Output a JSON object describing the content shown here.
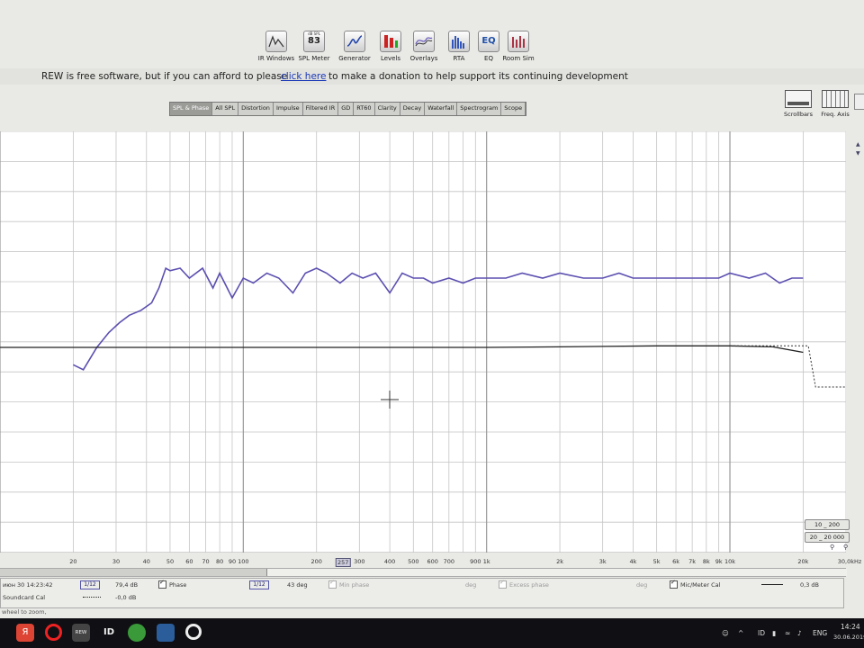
{
  "toolbar": {
    "buttons": [
      {
        "label": "IR Windows",
        "icon": "ir-window-icon"
      },
      {
        "label": "SPL Meter",
        "icon": "spl-meter-icon",
        "display": "83",
        "caption": "dB SPL"
      },
      {
        "label": "Generator",
        "icon": "generator-icon"
      },
      {
        "label": "Levels",
        "icon": "levels-icon"
      },
      {
        "label": "Overlays",
        "icon": "overlays-icon"
      },
      {
        "label": "RTA",
        "icon": "rta-icon"
      },
      {
        "label": "EQ",
        "icon": "eq-icon",
        "display": "EQ"
      },
      {
        "label": "Room Sim",
        "icon": "room-sim-icon"
      }
    ]
  },
  "banner": {
    "text_before": "REW is free software, but if you can afford to please",
    "link": "click here",
    "text_after": "to make a donation to help support its continuing development"
  },
  "tabs": [
    "SPL & Phase",
    "All SPL",
    "Distortion",
    "Impulse",
    "Filtered IR",
    "GD",
    "RT60",
    "Clarity",
    "Decay",
    "Waterfall",
    "Spectrogram",
    "Scope"
  ],
  "active_tab": "SPL & Phase",
  "right_tools": [
    {
      "label": "Scrollbars",
      "icon": "scrollbars-icon"
    },
    {
      "label": "Freq. Axis",
      "icon": "freq-axis-icon"
    }
  ],
  "x_axis": {
    "labels": [
      "20",
      "30",
      "40",
      "50",
      "60",
      "70",
      "80",
      "90",
      "100",
      "200",
      "257",
      "300",
      "400",
      "500",
      "600",
      "700",
      "900",
      "1k",
      "2k",
      "3k",
      "4k",
      "5k",
      "6k",
      "7k",
      "8k",
      "9k",
      "10k",
      "20k",
      "30,0kHz"
    ],
    "highlight": "257"
  },
  "range_buttons": [
    {
      "label": "10 _ 200"
    },
    {
      "label": "20 _ 20 000"
    }
  ],
  "legend": {
    "row1": {
      "name": "июн 30 14:23:42",
      "smoothing": "1/12",
      "level": "79,4 dB",
      "phase_label": "Phase",
      "phase_smoothing": "1/12",
      "phase_value": "43 deg",
      "min_phase_label": "Min phase",
      "min_phase_unit": "deg",
      "excess_phase_label": "Excess phase",
      "excess_phase_unit": "deg",
      "cal_label": "Mic/Meter Cal",
      "cal_value": "0,3 dB"
    },
    "row2": {
      "name": "Soundcard Cal",
      "level": "-0,0 dB"
    }
  },
  "status_text": "wheel to zoom,",
  "taskbar": {
    "apps": [
      "yandex-browser-icon",
      "opera-icon",
      "rew-app-icon",
      "id-app-icon",
      "green-app-icon",
      "blue-app-icon",
      "obs-icon"
    ],
    "app_labels": {
      "rew": "REW",
      "id": "ID"
    },
    "tray": {
      "lang_indicator": "ID",
      "language": "ENG",
      "time": "14:24",
      "date": "30.06.2019"
    }
  },
  "colors": {
    "spl_trace": "#5b4fb0",
    "phase_trace": "#222222",
    "grid": "#b8b8b8",
    "graph_bg": "#ffffff"
  },
  "chart_data": {
    "type": "line",
    "series": [
      {
        "name": "SPL",
        "x": [
          20,
          22,
          25,
          28,
          31,
          34,
          38,
          42,
          45,
          48,
          50,
          55,
          60,
          68,
          75,
          80,
          90,
          100,
          110,
          125,
          140,
          160,
          180,
          200,
          220,
          250,
          280,
          310,
          350,
          400,
          450,
          500,
          550,
          600,
          700,
          800,
          900,
          1000,
          1200,
          1400,
          1700,
          2000,
          2500,
          3000,
          3500,
          4000,
          5000,
          6000,
          7000,
          8000,
          9000,
          10000,
          12000,
          14000,
          16000,
          18000,
          20000
        ],
        "y": [
          -3.5,
          -4.5,
          0,
          3,
          5,
          6.5,
          7.5,
          9,
          12,
          16,
          15.5,
          16,
          14,
          16,
          12,
          15,
          10,
          14,
          13,
          15,
          14,
          11,
          15,
          16,
          15,
          13,
          15,
          14,
          15,
          11,
          15,
          14,
          14,
          13,
          14,
          13,
          14,
          14,
          14,
          15,
          14,
          15,
          14,
          14,
          15,
          14,
          14,
          14,
          14,
          14,
          14,
          15,
          14,
          15,
          13,
          14,
          14
        ]
      },
      {
        "name": "Phase",
        "x": [
          10,
          100,
          1000,
          2000,
          3000,
          5000,
          10000,
          15000,
          20000,
          25000,
          30000
        ],
        "y": [
          0,
          0,
          0,
          0.1,
          0.2,
          0.3,
          0.3,
          0.1,
          -1,
          -2,
          -2
        ]
      }
    ]
  }
}
